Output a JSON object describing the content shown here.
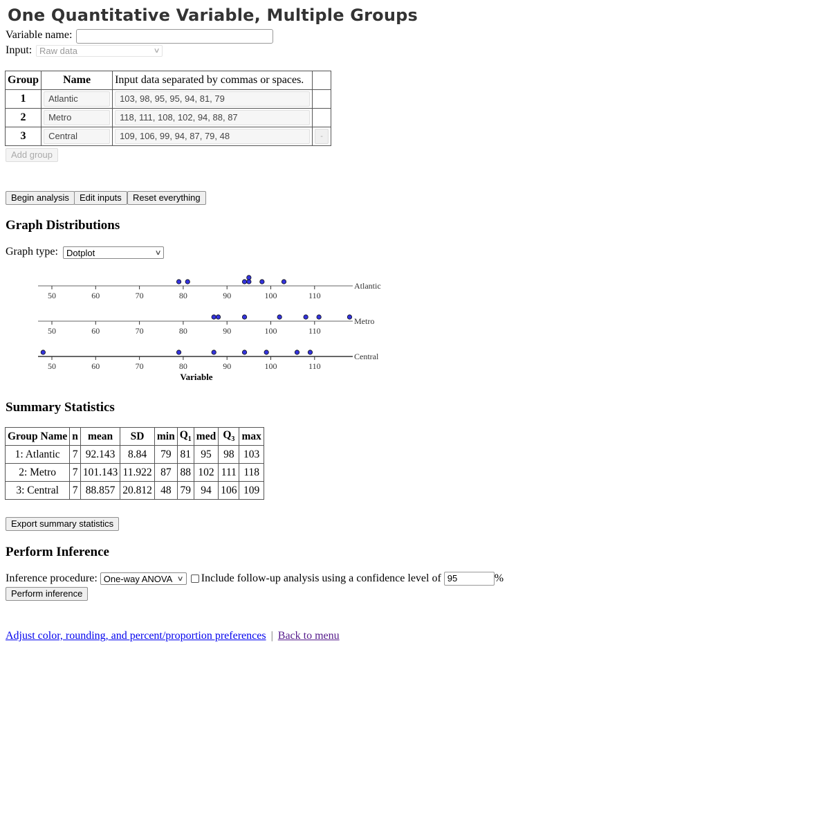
{
  "header": {
    "title": "One Quantitative Variable, Multiple Groups"
  },
  "variable_name": {
    "label": "Variable name:",
    "value": ""
  },
  "input_mode": {
    "label": "Input:",
    "selected": "Raw data"
  },
  "groups_table": {
    "headers": [
      "Group",
      "Name",
      "Input data separated by commas or spaces."
    ],
    "rows": [
      {
        "group": "1",
        "name": "Atlantic",
        "data": "103, 98, 95, 95, 94, 81, 79"
      },
      {
        "group": "2",
        "name": "Metro",
        "data": "118, 111, 108, 102, 94, 88, 87"
      },
      {
        "group": "3",
        "name": "Central",
        "data": "109, 106, 99, 94, 87, 79, 48"
      }
    ],
    "remove_label": "-",
    "add_group_label": "Add group"
  },
  "actions": {
    "begin": "Begin analysis",
    "edit": "Edit inputs",
    "reset": "Reset everything"
  },
  "graph": {
    "heading": "Graph Distributions",
    "type_label": "Graph type:",
    "type_selected": "Dotplot"
  },
  "chart_data": {
    "type": "scatter",
    "subtype": "dotplot",
    "xlabel": "Variable",
    "xticks": [
      50,
      60,
      70,
      80,
      90,
      100,
      110
    ],
    "xlim": [
      47,
      119
    ],
    "dot_color": "#3333dd",
    "series": [
      {
        "name": "Atlantic",
        "values": [
          103,
          98,
          95,
          95,
          94,
          81,
          79
        ]
      },
      {
        "name": "Metro",
        "values": [
          118,
          111,
          108,
          102,
          94,
          88,
          87
        ]
      },
      {
        "name": "Central",
        "values": [
          109,
          106,
          99,
          94,
          87,
          79,
          48
        ]
      }
    ]
  },
  "summary": {
    "heading": "Summary Statistics",
    "headers": [
      "Group Name",
      "n",
      "mean",
      "SD",
      "min",
      "Q1",
      "med",
      "Q3",
      "max"
    ],
    "rows": [
      [
        "1: Atlantic",
        "7",
        "92.143",
        "8.84",
        "79",
        "81",
        "95",
        "98",
        "103"
      ],
      [
        "2: Metro",
        "7",
        "101.143",
        "11.922",
        "87",
        "88",
        "102",
        "111",
        "118"
      ],
      [
        "3: Central",
        "7",
        "88.857",
        "20.812",
        "48",
        "79",
        "94",
        "106",
        "109"
      ]
    ],
    "export_label": "Export summary statistics"
  },
  "inference": {
    "heading": "Perform Inference",
    "procedure_label": "Inference procedure:",
    "procedure_selected": "One-way ANOVA",
    "followup_label": "Include follow-up analysis using a confidence level of",
    "followup_checked": false,
    "confidence": "95",
    "percent": "%",
    "perform_label": "Perform inference"
  },
  "footer": {
    "prefs_link": "Adjust color, rounding, and percent/proportion preferences",
    "separator": "|",
    "menu_link": "Back to menu"
  }
}
